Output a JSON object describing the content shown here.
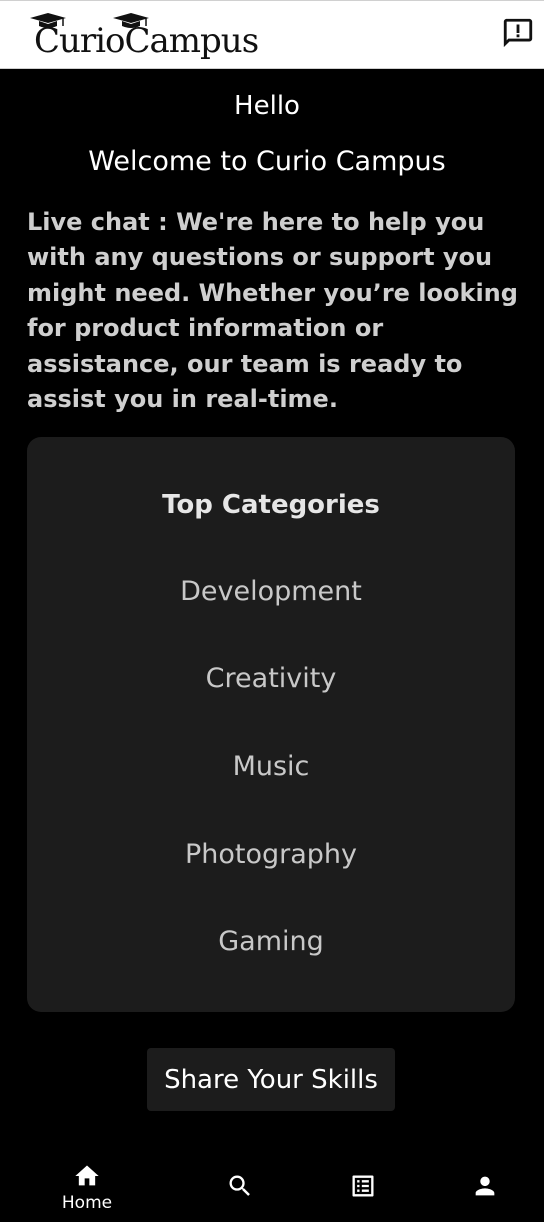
{
  "header": {
    "logo_text": "CurioCampus",
    "feedback_icon": "feedback-icon"
  },
  "main": {
    "hello": "Hello",
    "welcome": "Welcome to Curio Campus",
    "live_chat": "Live chat : We're here to help you with any questions or support you might need. Whether you’re looking for product information or assistance, our team is ready to assist you in real-time."
  },
  "categories": {
    "title": "Top Categories",
    "items": [
      "Development",
      "Creativity",
      "Music",
      "Photography",
      "Gaming"
    ]
  },
  "share_button": {
    "label": "Share Your Skills"
  },
  "bottom_nav": {
    "items": [
      {
        "label": "Home",
        "icon": "home-icon"
      },
      {
        "label": "",
        "icon": "search-icon"
      },
      {
        "label": "",
        "icon": "list-icon"
      },
      {
        "label": "",
        "icon": "person-icon"
      }
    ]
  },
  "colors": {
    "background": "#000000",
    "header_bg": "#ffffff",
    "card_bg": "#1c1c1c",
    "primary_text": "#ffffff",
    "secondary_text": "#cfcfcf"
  }
}
